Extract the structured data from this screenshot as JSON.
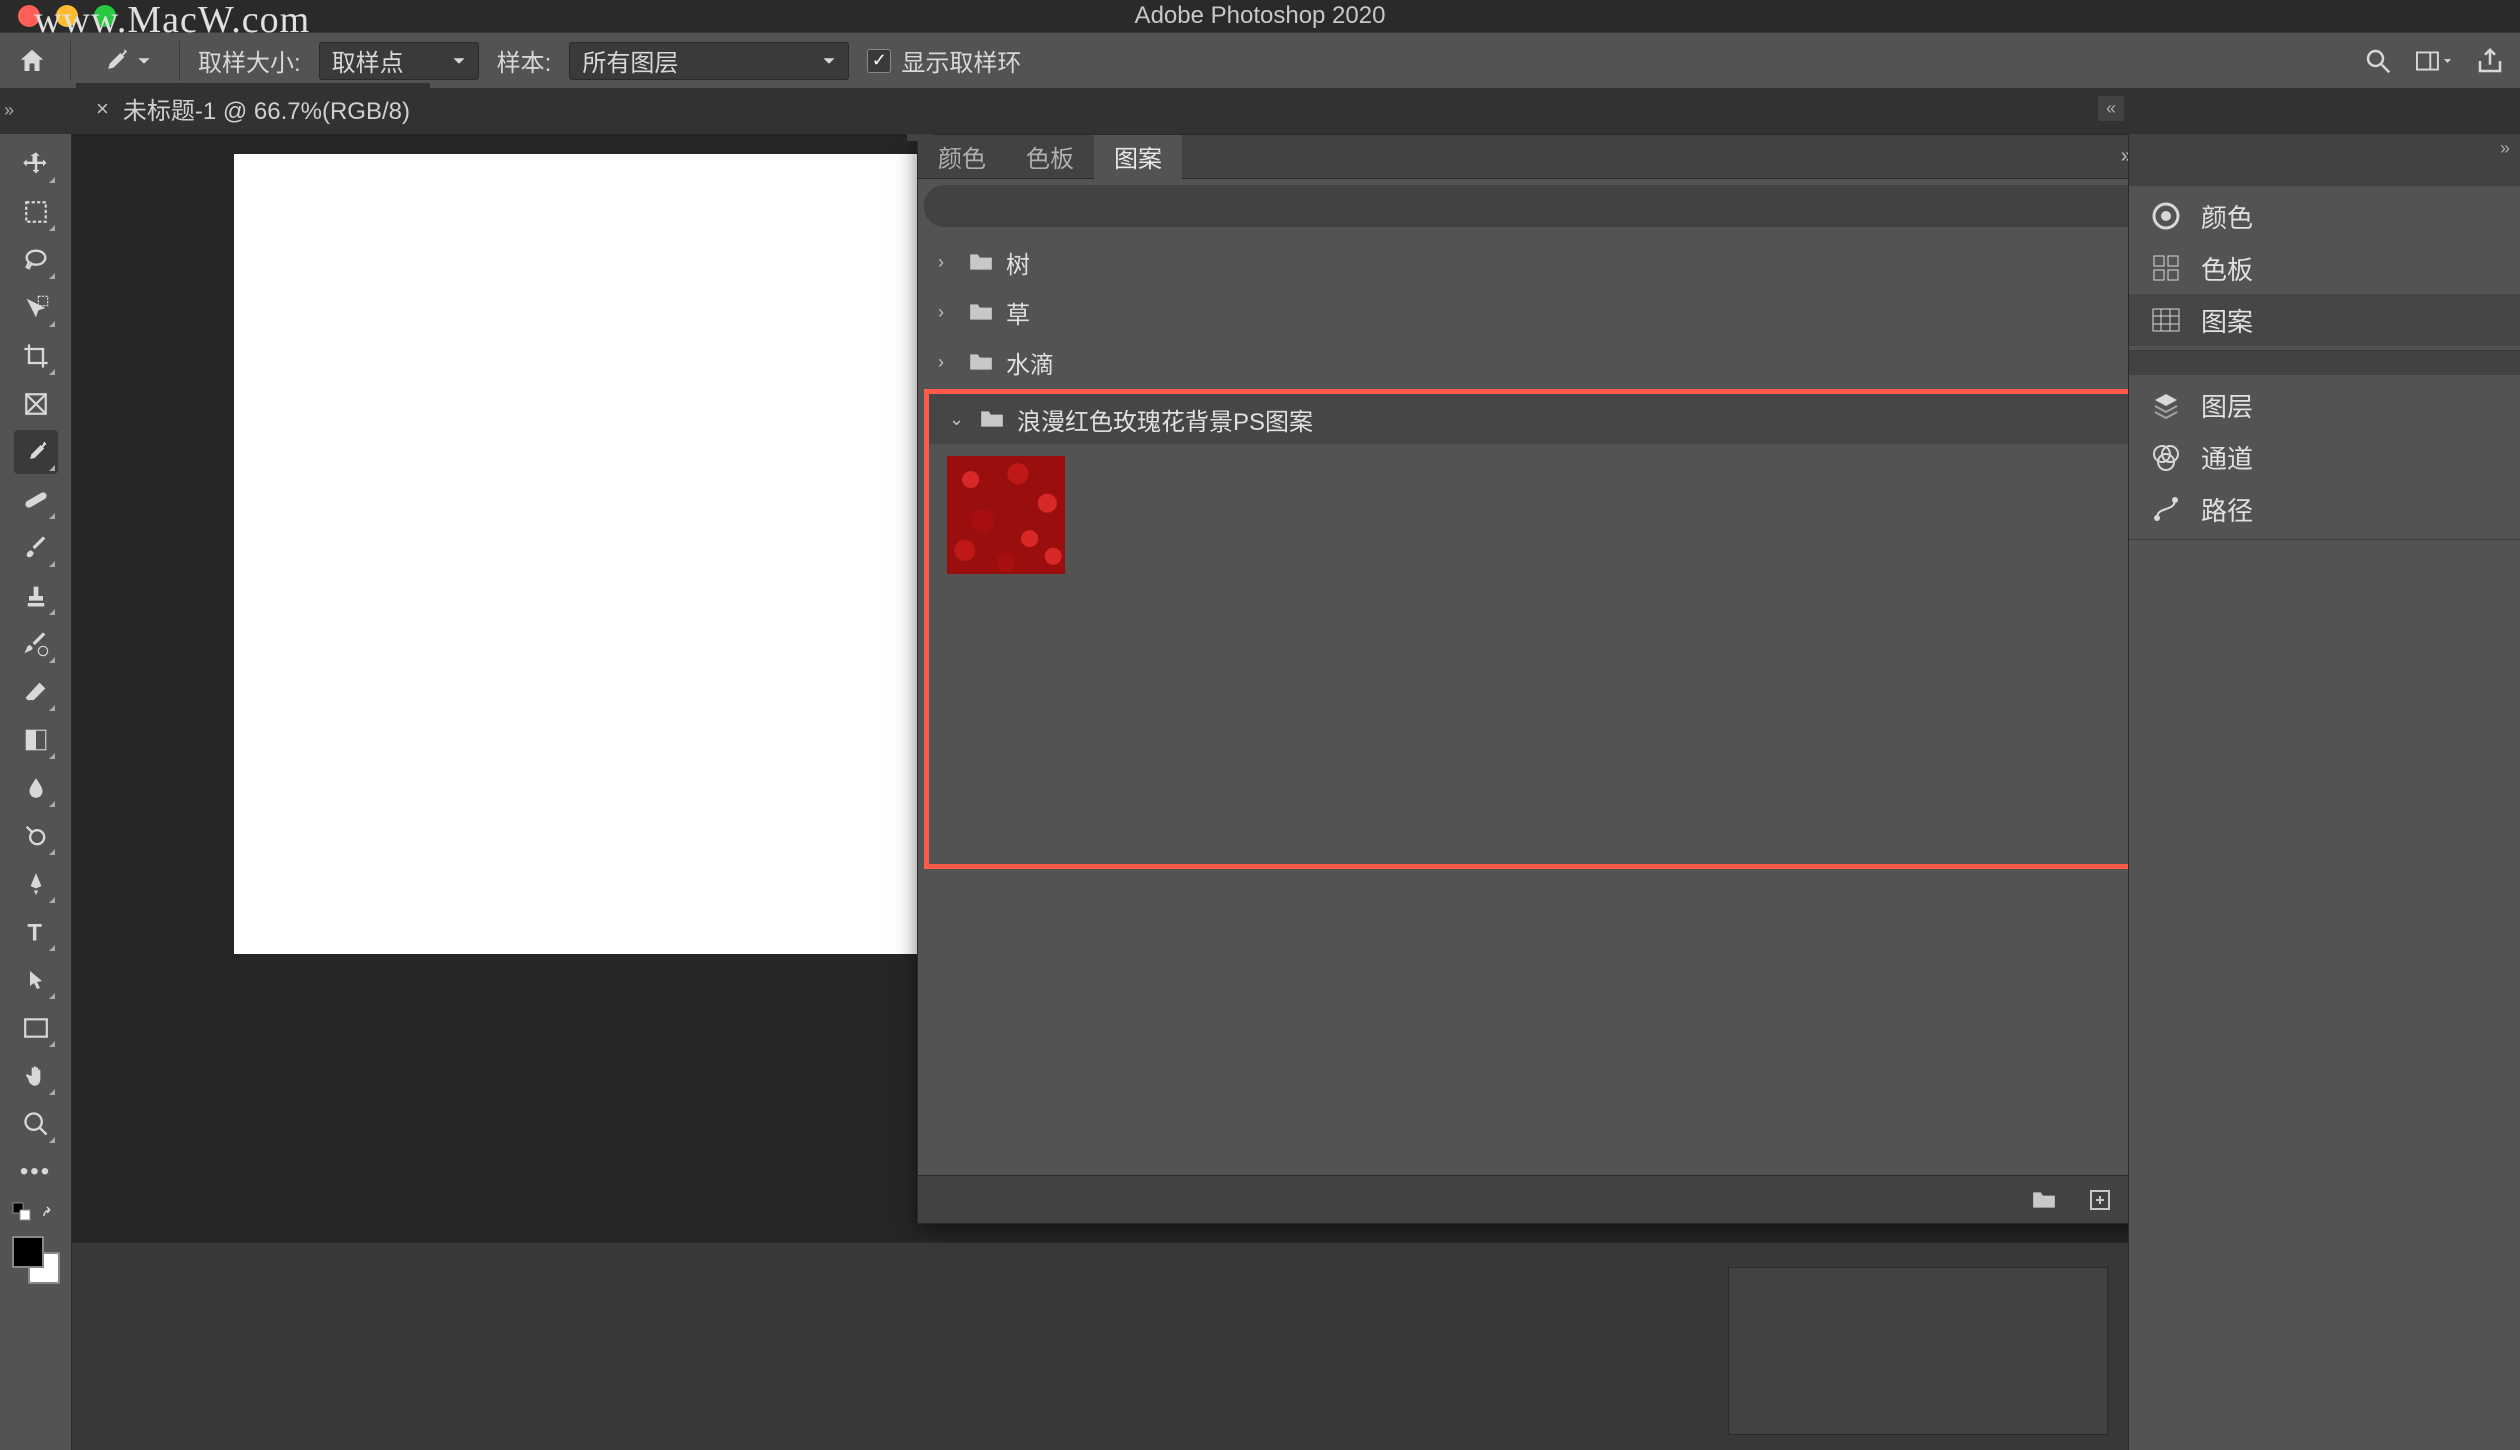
{
  "watermark": "www.MacW.com",
  "app_title": "Adobe Photoshop 2020",
  "options_bar": {
    "sample_size_label": "取样大小:",
    "sample_size_value": "取样点",
    "sample_label": "样本:",
    "sample_value": "所有图层",
    "show_ring_label": "显示取样环"
  },
  "document": {
    "tab_label": "未标题-1 @ 66.7%(RGB/8)"
  },
  "patterns_panel": {
    "tabs": {
      "color": "颜色",
      "swatches": "色板",
      "patterns": "图案"
    },
    "folders": [
      {
        "name": "树",
        "expanded": false
      },
      {
        "name": "草",
        "expanded": false
      },
      {
        "name": "水滴",
        "expanded": false
      },
      {
        "name": "浪漫红色玫瑰花背景PS图案",
        "expanded": true,
        "highlighted": true
      }
    ]
  },
  "right_dock": {
    "items_group1": [
      {
        "label": "颜色",
        "icon": "color-wheel"
      },
      {
        "label": "色板",
        "icon": "swatches-grid"
      },
      {
        "label": "图案",
        "icon": "patterns-grid",
        "active": true
      }
    ],
    "items_group2": [
      {
        "label": "图层",
        "icon": "layers"
      },
      {
        "label": "通道",
        "icon": "channels"
      },
      {
        "label": "路径",
        "icon": "paths"
      }
    ]
  }
}
